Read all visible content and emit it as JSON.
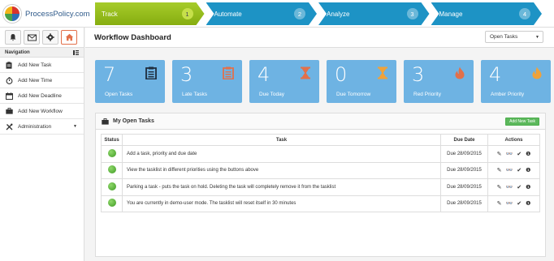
{
  "brand": {
    "name": "ProcessPolicy.com"
  },
  "steps": [
    {
      "label": "Track",
      "num": "1"
    },
    {
      "label": "Automate",
      "num": "2"
    },
    {
      "label": "Analyze",
      "num": "3"
    },
    {
      "label": "Manage",
      "num": "4"
    }
  ],
  "sidebar": {
    "nav_heading": "Navigation",
    "items": [
      {
        "label": "Add New Task"
      },
      {
        "label": "Add New Time"
      },
      {
        "label": "Add New Deadline"
      },
      {
        "label": "Add New Workflow"
      },
      {
        "label": "Administration"
      }
    ]
  },
  "header": {
    "title": "Workflow Dashboard",
    "select_value": "Open Tasks"
  },
  "cards": [
    {
      "count": "7",
      "label": "Open Tasks",
      "icon": "clipboard-icon",
      "icon_color": "#1f2d3d"
    },
    {
      "count": "3",
      "label": "Late Tasks",
      "icon": "clipboard-icon",
      "icon_color": "#e2704a"
    },
    {
      "count": "4",
      "label": "Due Today",
      "icon": "hourglass-icon",
      "icon_color": "#e2704a"
    },
    {
      "count": "0",
      "label": "Due Tomorrow",
      "icon": "hourglass-icon",
      "icon_color": "#f0a23a"
    },
    {
      "count": "3",
      "label": "Red Priority",
      "icon": "flame-icon",
      "icon_color": "#e2704a"
    },
    {
      "count": "4",
      "label": "Amber Priority",
      "icon": "flame-icon",
      "icon_color": "#f0a23a"
    }
  ],
  "panel": {
    "title": "My Open Tasks",
    "add_button": "Add New Task",
    "columns": {
      "status": "Status",
      "task": "Task",
      "due": "Due Date",
      "actions": "Actions"
    },
    "rows": [
      {
        "task": "Add a task, priority and due date",
        "due": "Due 28/09/2015"
      },
      {
        "task": "View the tasklist in different priorities using the buttons above",
        "due": "Due 28/09/2015"
      },
      {
        "task": "Parking a task - puts the task on hold. Deleting the task will completely remove it from the tasklist",
        "due": "Due 28/09/2015"
      },
      {
        "task": "You are currently in demo-user mode. The tasklist will reset itself in 30 minutes",
        "due": "Due 28/09/2015"
      }
    ]
  }
}
